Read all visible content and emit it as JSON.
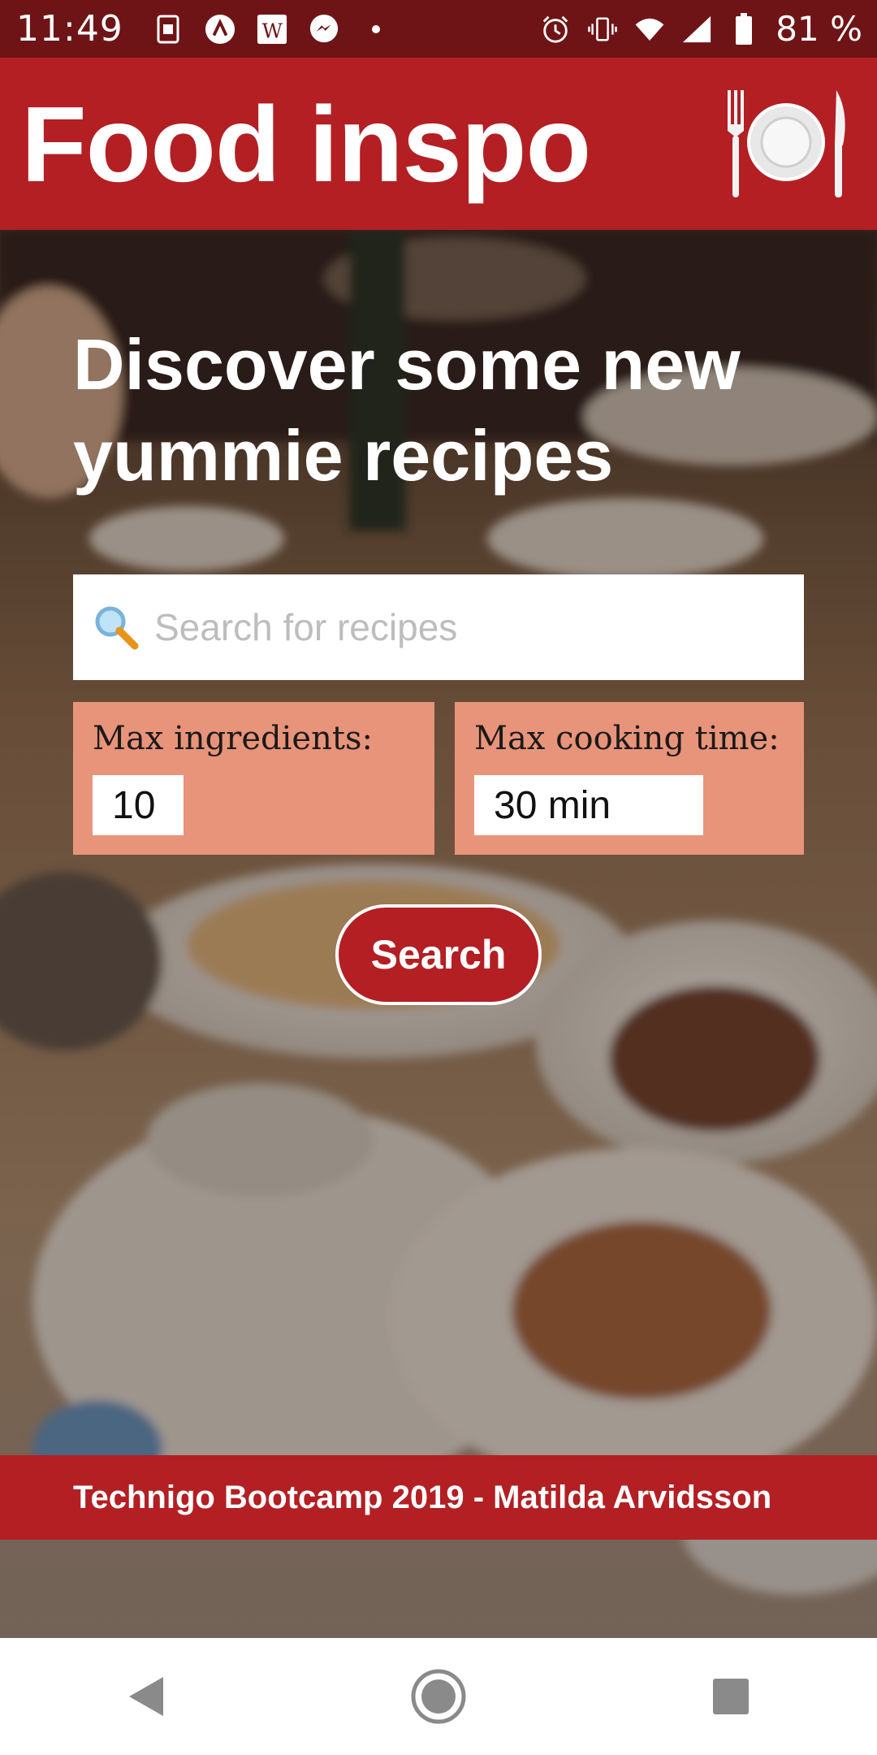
{
  "status_bar": {
    "time": "11:49",
    "battery": "81 %",
    "left_icons": [
      "sim-icon",
      "app-icon",
      "word-icon",
      "messenger-icon",
      "dot-icon"
    ],
    "right_icons": [
      "alarm-icon",
      "vibrate-icon",
      "wifi-icon",
      "signal-icon",
      "battery-icon"
    ]
  },
  "header": {
    "title": "Food inspo",
    "icon": "plate-cutlery-icon"
  },
  "hero": {
    "headline": "Discover some new yummie recipes",
    "search": {
      "placeholder": "Search for recipes",
      "value": "",
      "icon": "search-icon"
    },
    "filters": {
      "ingredients_label": "Max ingredients:",
      "ingredients_value": "10",
      "time_label": "Max cooking time:",
      "time_value": "30 min"
    },
    "search_button": "Search"
  },
  "footer": {
    "text": "Technigo Bootcamp 2019 - Matilda Arvidsson"
  },
  "colors": {
    "brand": "#b31f23",
    "status_bar": "#6f1416",
    "filter_box": "#e8947a"
  },
  "nav": [
    "back-icon",
    "home-icon",
    "recents-icon"
  ]
}
